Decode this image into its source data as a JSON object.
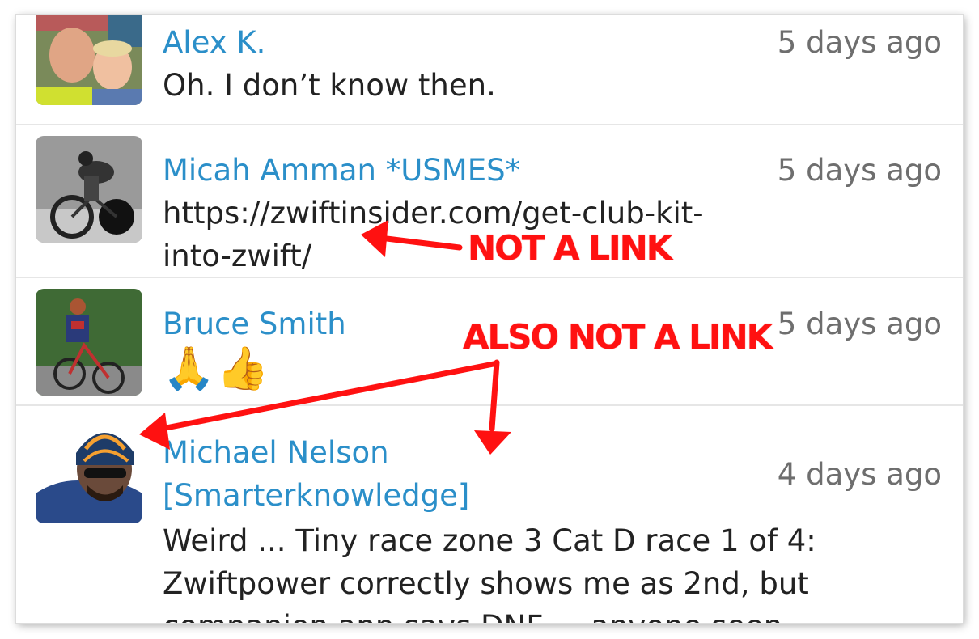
{
  "messages": [
    {
      "name": "Alex K.",
      "time": "5 days ago",
      "body": "Oh. I don’t know then."
    },
    {
      "name": "Micah  Amman *USMES*",
      "time": "5 days ago",
      "body_lines": [
        "https://zwiftinsider.com/get-club-kit-",
        "into-zwift/"
      ]
    },
    {
      "name": "Bruce Smith",
      "time": "5 days ago",
      "body": "🙏👍"
    },
    {
      "name_lines": [
        "Michael Nelson",
        "[Smarterknowledge]"
      ],
      "time": "4 days ago",
      "body_lines": [
        "Weird ... Tiny race zone 3 Cat D race 1 of 4:",
        "Zwiftpower correctly shows me as 2nd, but",
        "companion app says DNF ... anyone seen"
      ]
    }
  ],
  "annotations": {
    "first": "NOT A LINK",
    "second": "ALSO NOT A LINK"
  },
  "colors": {
    "name": "#2b8fc9",
    "time": "#6e6e6e",
    "annotation": "#ff1111"
  }
}
